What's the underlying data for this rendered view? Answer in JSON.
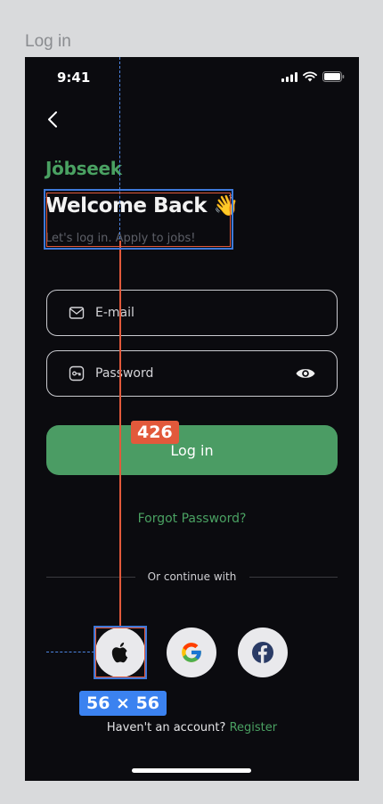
{
  "frame_title": "Log in",
  "status": {
    "time": "9:41"
  },
  "brand": "Jöbseek",
  "welcome": {
    "title": "Welcome Back",
    "emoji": "👋",
    "subtitle": "Let's log in. Apply to jobs!"
  },
  "form": {
    "email_placeholder": "E-mail",
    "password_placeholder": "Password",
    "login_label": "Log in",
    "forgot_label": "Forgot Password?"
  },
  "divider_text": "Or continue with",
  "social": [
    "apple-icon",
    "google-icon",
    "facebook-icon"
  ],
  "register": {
    "prompt": "Haven't an account?",
    "link": "Register"
  },
  "annotations": {
    "spacing_label": "426",
    "size_label": "56 × 56"
  },
  "colors": {
    "accent": "#4b9c64",
    "background": "#0b0b0f",
    "guide_red": "#e2593b",
    "guide_blue": "#3b82f0"
  }
}
